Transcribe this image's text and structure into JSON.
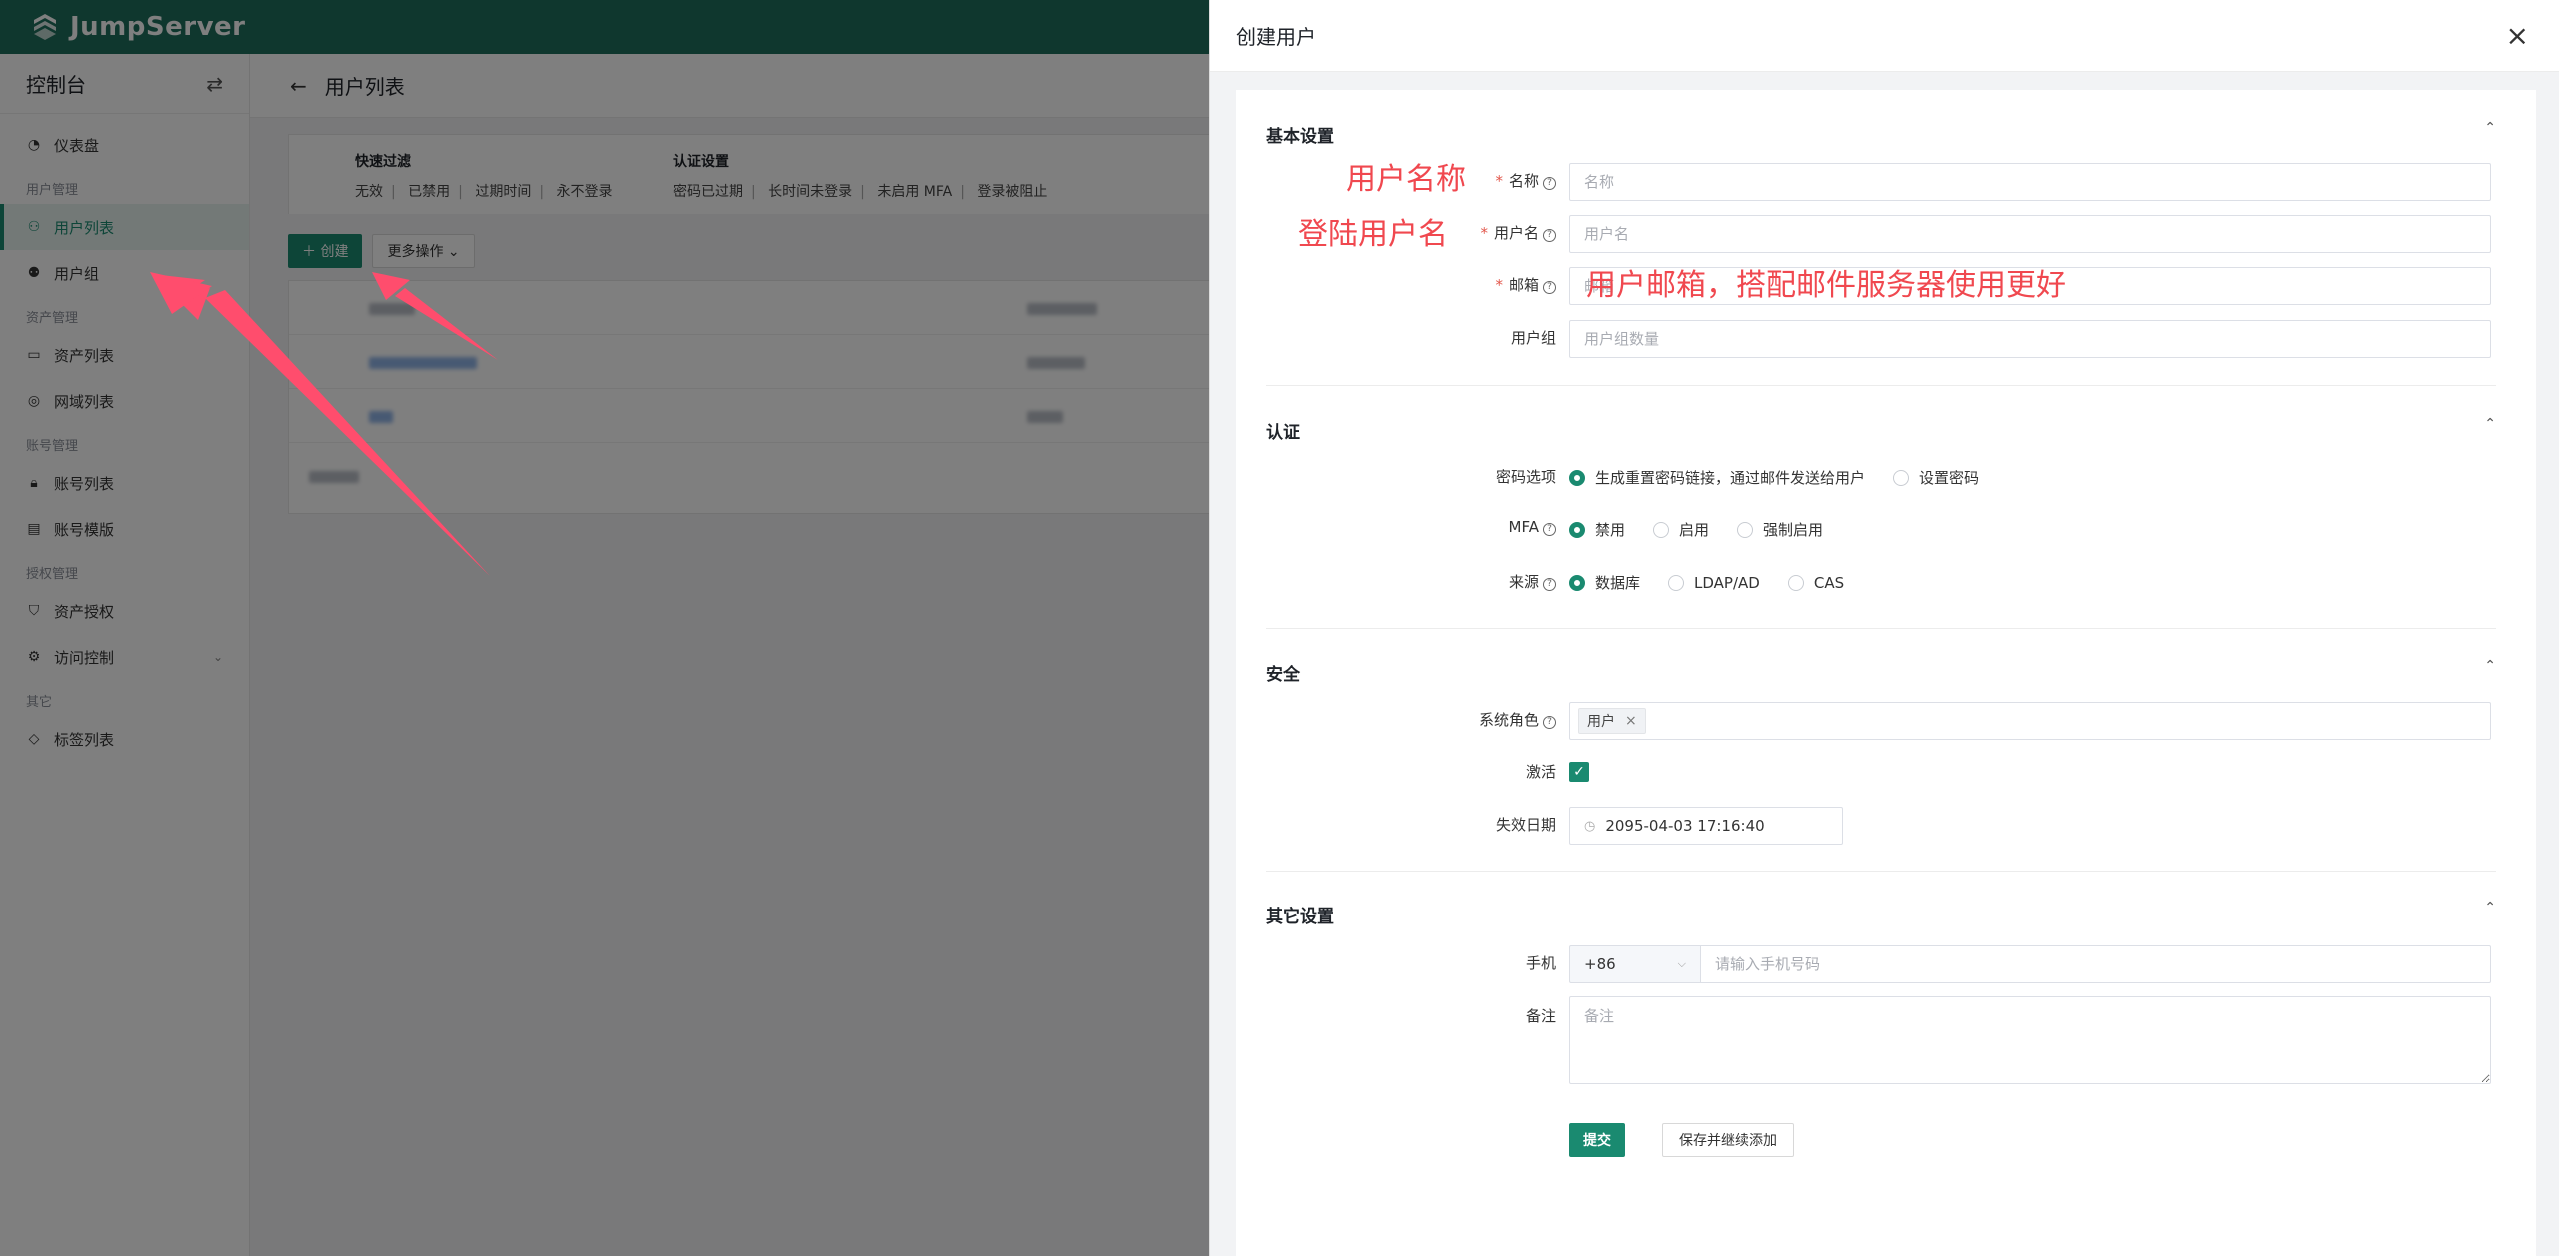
{
  "app": {
    "brand": "JumpServer"
  },
  "sidebar": {
    "title": "控制台",
    "groups": [
      {
        "items": [
          {
            "label": "仪表盘",
            "icon": "dashboard-icon"
          }
        ]
      },
      {
        "label": "用户管理",
        "items": [
          {
            "label": "用户列表",
            "icon": "user-icon",
            "active": true
          },
          {
            "label": "用户组",
            "icon": "users-icon"
          }
        ]
      },
      {
        "label": "资产管理",
        "items": [
          {
            "label": "资产列表",
            "icon": "monitor-icon"
          },
          {
            "label": "网域列表",
            "icon": "location-icon"
          }
        ]
      },
      {
        "label": "账号管理",
        "items": [
          {
            "label": "账号列表",
            "icon": "lock-icon"
          },
          {
            "label": "账号模版",
            "icon": "template-icon"
          }
        ]
      },
      {
        "label": "授权管理",
        "items": [
          {
            "label": "资产授权",
            "icon": "shield-icon"
          },
          {
            "label": "访问控制",
            "icon": "gear-icon"
          }
        ]
      },
      {
        "label": "其它",
        "items": [
          {
            "label": "标签列表",
            "icon": "tag-icon"
          }
        ]
      }
    ]
  },
  "page": {
    "title": "用户列表",
    "quick_filter": {
      "title": "快速过滤",
      "items": [
        "无效",
        "已禁用",
        "过期时间",
        "永不登录"
      ]
    },
    "auth_filter": {
      "title": "认证设置",
      "items": [
        "密码已过期",
        "长时间未登录",
        "未启用 MFA",
        "登录被阻止"
      ]
    },
    "create_label": "创建",
    "more_label": "更多操作"
  },
  "drawer": {
    "title": "创建用户",
    "sections": {
      "basic": "基本设置",
      "auth": "认证",
      "security": "安全",
      "other": "其它设置"
    },
    "fields": {
      "name": {
        "label": "名称",
        "placeholder": "名称"
      },
      "username": {
        "label": "用户名",
        "placeholder": "用户名"
      },
      "email": {
        "label": "邮箱",
        "placeholder": "邮箱"
      },
      "groups": {
        "label": "用户组",
        "placeholder": "用户组数量"
      },
      "password_option": {
        "label": "密码选项",
        "options": [
          "生成重置密码链接，通过邮件发送给用户",
          "设置密码"
        ],
        "selected": 0
      },
      "mfa": {
        "label": "MFA",
        "options": [
          "禁用",
          "启用",
          "强制启用"
        ],
        "selected": 0
      },
      "source": {
        "label": "来源",
        "options": [
          "数据库",
          "LDAP/AD",
          "CAS"
        ],
        "selected": 0
      },
      "system_role": {
        "label": "系统角色",
        "tag": "用户"
      },
      "active": {
        "label": "激活",
        "checked": true
      },
      "expire": {
        "label": "失效日期",
        "value": "2095-04-03 17:16:40"
      },
      "phone": {
        "label": "手机",
        "prefix": "+86",
        "placeholder": "请输入手机号码"
      },
      "comment": {
        "label": "备注",
        "placeholder": "备注"
      }
    },
    "submit_label": "提交",
    "save_continue_label": "保存并继续添加"
  },
  "annotations": {
    "name_note": "用户名称",
    "username_note": "登陆用户名",
    "email_note": "用户邮箱，搭配邮件服务器使用更好"
  },
  "colors": {
    "brand": "#1f6e5c",
    "accent": "#1a8a70",
    "annotation": "#f0484f",
    "required": "#e2574c"
  }
}
